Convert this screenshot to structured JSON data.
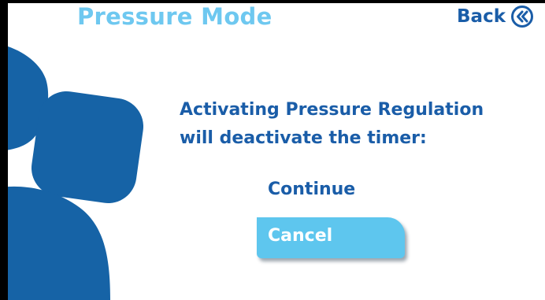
{
  "header": {
    "title": "Pressure Mode",
    "back_label": "Back",
    "back_icon": "double-chevron-left-icon"
  },
  "dialog": {
    "message_line1": "Activating Pressure Regulation",
    "message_line2": "will deactivate the timer:",
    "continue_label": "Continue",
    "cancel_label": "Cancel"
  },
  "colors": {
    "title": "#6ec8f0",
    "text": "#1a5da8",
    "decoration": "#1663a6",
    "cancel_button": "#5ec6ee"
  }
}
